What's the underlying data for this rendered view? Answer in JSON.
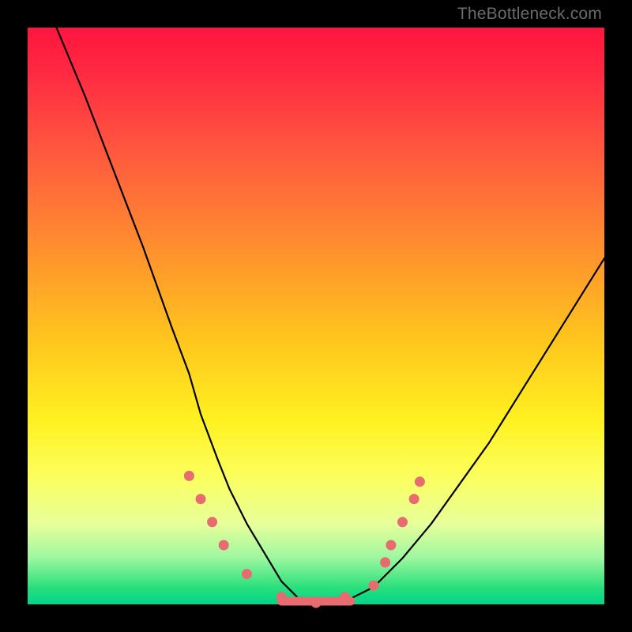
{
  "attribution": "TheBottleneck.com",
  "chart_data": {
    "type": "line",
    "title": "",
    "xlabel": "",
    "ylabel": "",
    "ylim": [
      0,
      100
    ],
    "xlim": [
      0,
      100
    ],
    "series": [
      {
        "name": "bottleneck-curve",
        "description": "V-shaped bottleneck curve; y represents bottleneck percentage (0 at valley, 100 at top), x is a nominal position along the curve",
        "x": [
          5,
          10,
          15,
          20,
          25,
          28,
          30,
          33,
          35,
          38,
          41,
          44,
          47,
          50,
          53,
          56,
          60,
          65,
          70,
          75,
          80,
          85,
          90,
          95,
          100
        ],
        "values": [
          100,
          88,
          75,
          62,
          48,
          40,
          33,
          25,
          20,
          14,
          9,
          4,
          1,
          0,
          0,
          1,
          3,
          8,
          14,
          21,
          28,
          36,
          44,
          52,
          60
        ]
      }
    ],
    "markers": {
      "name": "highlight-dots",
      "description": "salmon sample markers along the lower portion of the curve",
      "points": [
        {
          "x": 28,
          "y": 22
        },
        {
          "x": 30,
          "y": 18
        },
        {
          "x": 32,
          "y": 14
        },
        {
          "x": 34,
          "y": 10
        },
        {
          "x": 38,
          "y": 5
        },
        {
          "x": 44,
          "y": 1
        },
        {
          "x": 50,
          "y": 0
        },
        {
          "x": 55,
          "y": 1
        },
        {
          "x": 60,
          "y": 3
        },
        {
          "x": 62,
          "y": 7
        },
        {
          "x": 63,
          "y": 10
        },
        {
          "x": 65,
          "y": 14
        },
        {
          "x": 67,
          "y": 18
        },
        {
          "x": 68,
          "y": 21
        }
      ]
    },
    "flat_segment": {
      "name": "zero-bottleneck-band",
      "x_start": 44,
      "x_end": 56,
      "y": 0
    },
    "background_gradient_stops": [
      {
        "pct": 0,
        "color": "#ff153f"
      },
      {
        "pct": 50,
        "color": "#ffd21e"
      },
      {
        "pct": 80,
        "color": "#fbff5f"
      },
      {
        "pct": 100,
        "color": "#00d58b"
      }
    ]
  }
}
